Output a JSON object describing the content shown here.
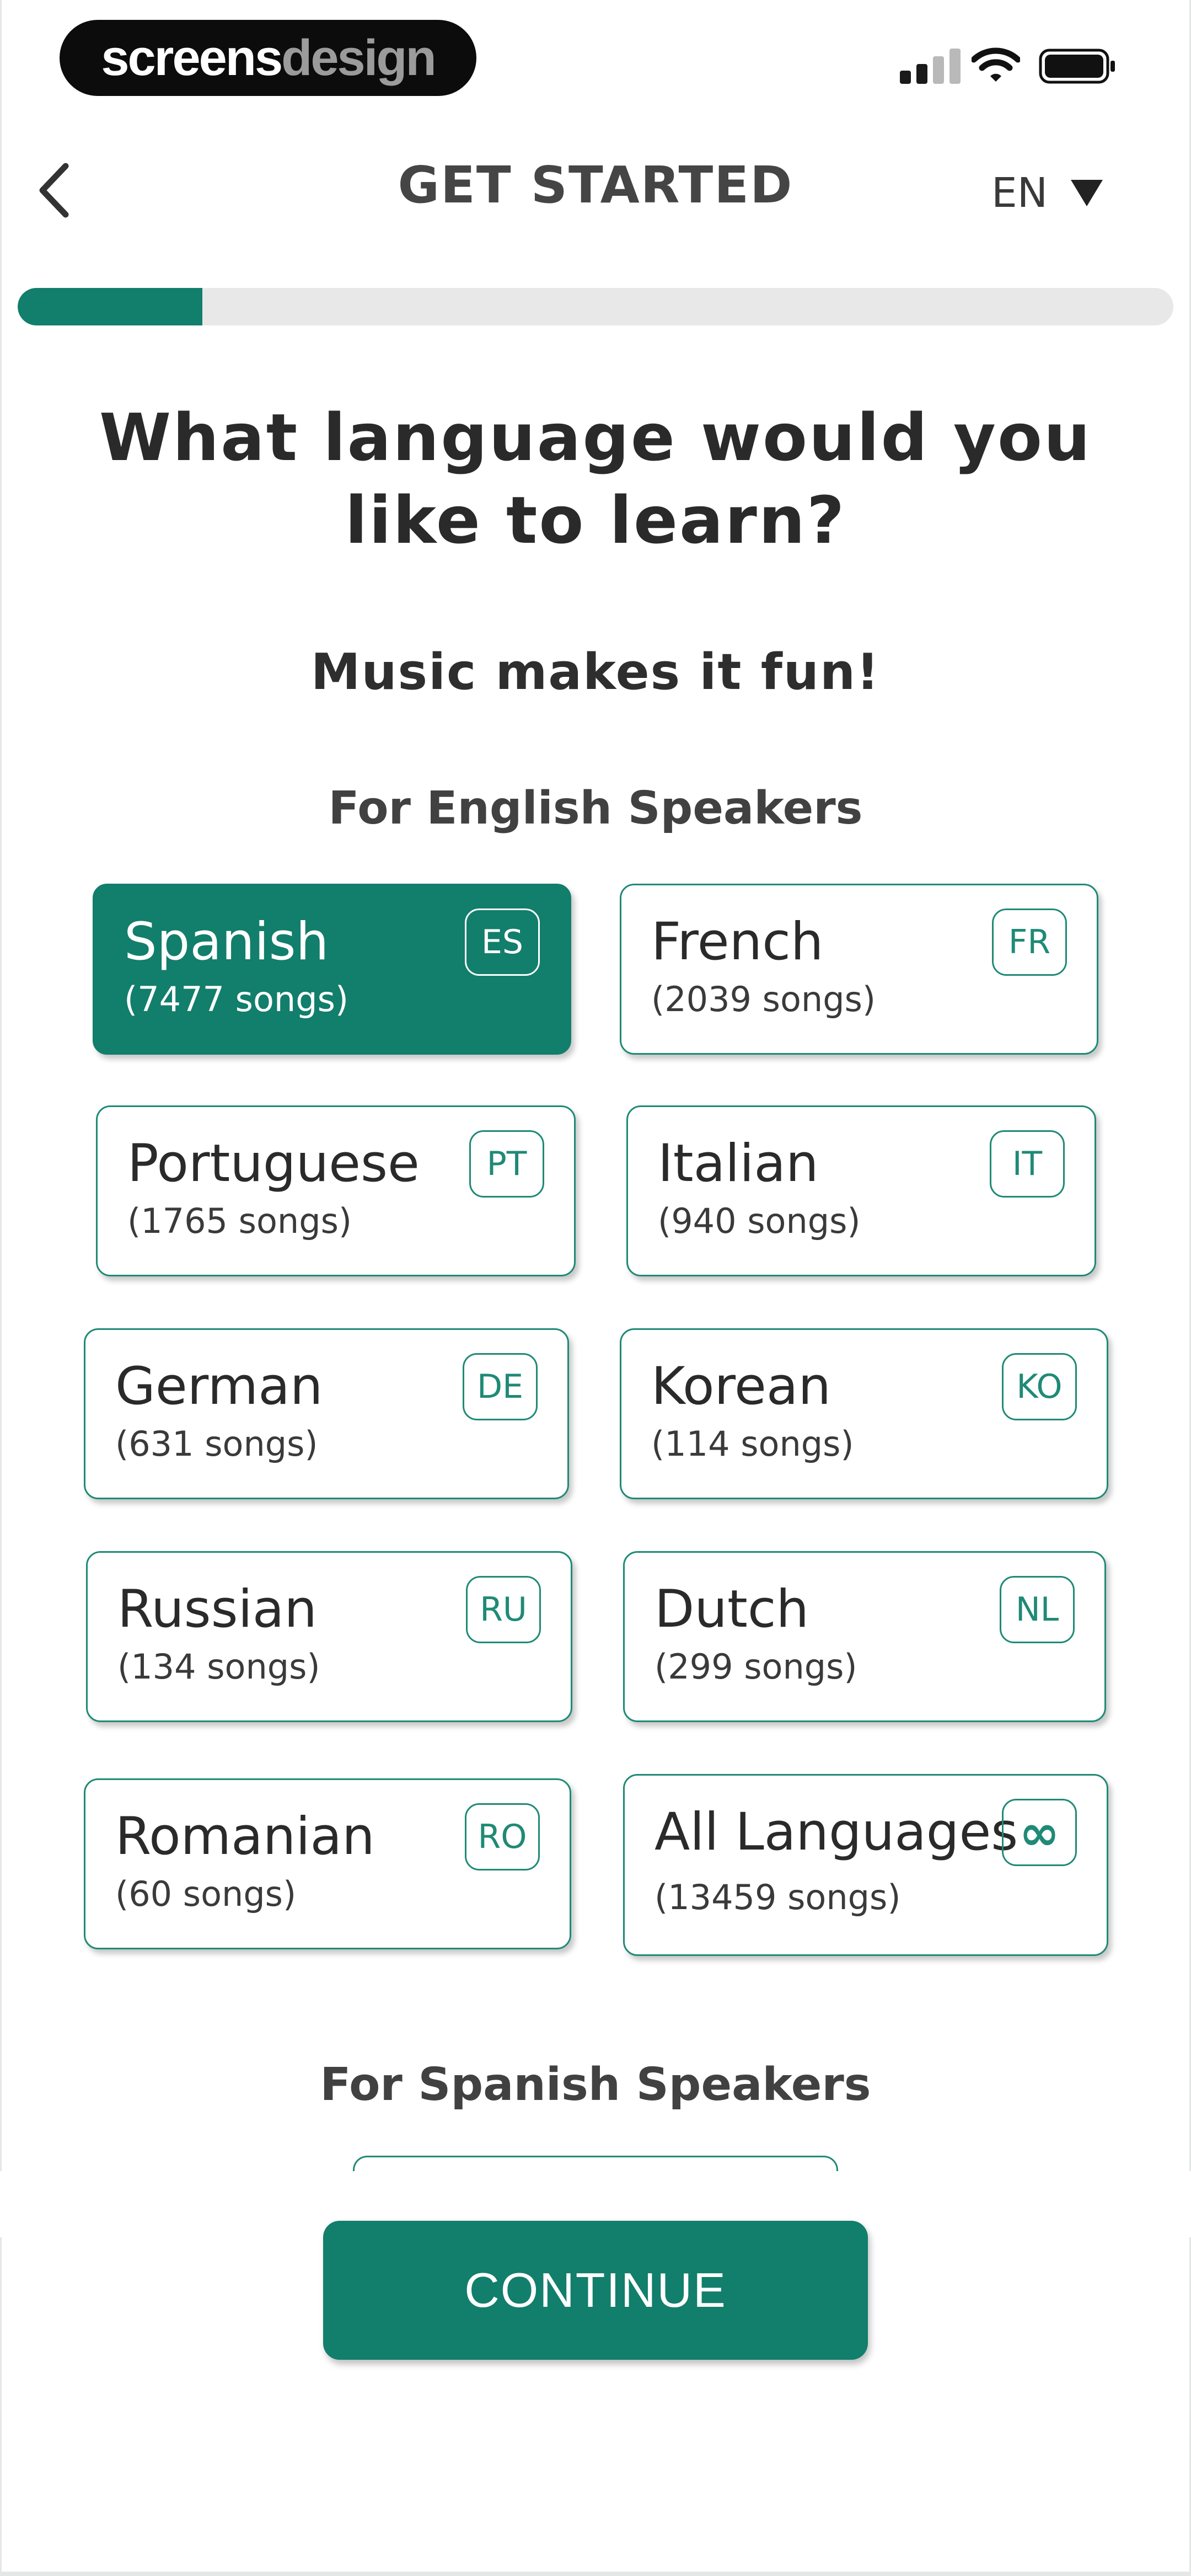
{
  "status_bar": {
    "brand_part1": "screens",
    "brand_part2": "design",
    "icons": [
      "cellular-signal-icon",
      "wifi-icon",
      "battery-icon"
    ]
  },
  "header": {
    "title": "GET STARTED",
    "language_code": "EN",
    "icons": [
      "chevron-left-icon",
      "triangle-down-icon"
    ]
  },
  "progress": {
    "fraction": 0.16
  },
  "question": "What language would you like to learn?",
  "subtitle": "Music makes it fun!",
  "sections": [
    {
      "heading": "For English Speakers",
      "languages": [
        {
          "name": "Spanish",
          "count": "(7477 songs)",
          "code": "ES",
          "selected": true
        },
        {
          "name": "French",
          "count": "(2039 songs)",
          "code": "FR",
          "selected": false
        },
        {
          "name": "Portuguese",
          "count": "(1765 songs)",
          "code": "PT",
          "selected": false
        },
        {
          "name": "Italian",
          "count": "(940 songs)",
          "code": "IT",
          "selected": false
        },
        {
          "name": "German",
          "count": "(631 songs)",
          "code": "DE",
          "selected": false
        },
        {
          "name": "Korean",
          "count": "(114 songs)",
          "code": "KO",
          "selected": false
        },
        {
          "name": "Russian",
          "count": "(134 songs)",
          "code": "RU",
          "selected": false
        },
        {
          "name": "Dutch",
          "count": "(299 songs)",
          "code": "NL",
          "selected": false
        },
        {
          "name": "Romanian",
          "count": "(60 songs)",
          "code": "RO",
          "selected": false
        },
        {
          "name": "All Languages",
          "count": "(13459 songs)",
          "code": "∞",
          "selected": false
        }
      ]
    },
    {
      "heading": "For Spanish Speakers"
    }
  ],
  "continue_label": "CONTINUE",
  "colors": {
    "accent": "#127e6c",
    "track": "#e8e8e8",
    "text_dark": "#2a2a2a"
  }
}
